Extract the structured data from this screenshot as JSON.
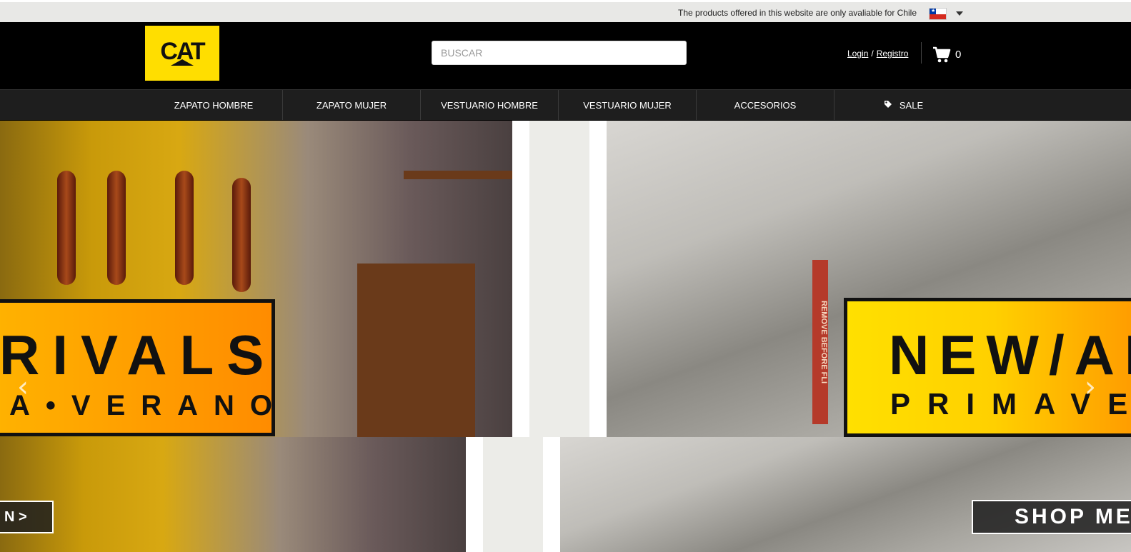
{
  "topbar": {
    "notice": "The products offered in this website are only avaliable for Chile",
    "country_flag": "chile-flag"
  },
  "header": {
    "logo_text": "CAT",
    "search_placeholder": "BUSCAR",
    "login_label": "Login",
    "separator": "/",
    "register_label": "Registro",
    "cart_count": "0"
  },
  "nav": {
    "items": [
      {
        "label": "ZAPATO HOMBRE"
      },
      {
        "label": "ZAPATO MUJER"
      },
      {
        "label": "VESTUARIO HOMBRE"
      },
      {
        "label": "VESTUARIO MUJER"
      },
      {
        "label": "ACCESORIOS"
      },
      {
        "label": "SALE",
        "icon": "tag-icon"
      }
    ]
  },
  "hero": {
    "left_banner_big": "RIVALS",
    "left_banner_small": "A•VERANO",
    "right_banner_big": "NEW/AR",
    "right_banner_small": "PRIMAVER",
    "strap_text": "REMOVE BEFORE FLI",
    "shop_left_label": "N  >",
    "shop_right_label": "SHOP MEN",
    "prev_arrow": "‹",
    "next_arrow": "›"
  },
  "colors": {
    "brand_yellow": "#ffde00",
    "header_bg": "#000000",
    "nav_bg": "#1e1e1e",
    "banner_orange": "#ff9a00"
  }
}
